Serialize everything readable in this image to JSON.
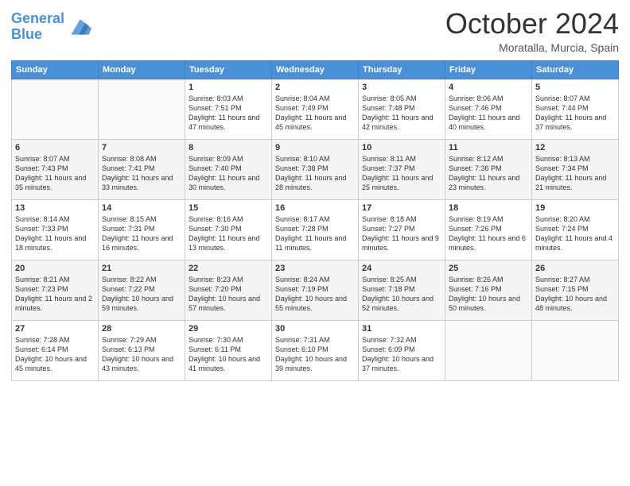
{
  "header": {
    "logo_line1": "General",
    "logo_line2": "Blue",
    "month": "October 2024",
    "location": "Moratalla, Murcia, Spain"
  },
  "days_of_week": [
    "Sunday",
    "Monday",
    "Tuesday",
    "Wednesday",
    "Thursday",
    "Friday",
    "Saturday"
  ],
  "weeks": [
    [
      {
        "day": "",
        "info": ""
      },
      {
        "day": "",
        "info": ""
      },
      {
        "day": "1",
        "info": "Sunrise: 8:03 AM\nSunset: 7:51 PM\nDaylight: 11 hours and 47 minutes."
      },
      {
        "day": "2",
        "info": "Sunrise: 8:04 AM\nSunset: 7:49 PM\nDaylight: 11 hours and 45 minutes."
      },
      {
        "day": "3",
        "info": "Sunrise: 8:05 AM\nSunset: 7:48 PM\nDaylight: 11 hours and 42 minutes."
      },
      {
        "day": "4",
        "info": "Sunrise: 8:06 AM\nSunset: 7:46 PM\nDaylight: 11 hours and 40 minutes."
      },
      {
        "day": "5",
        "info": "Sunrise: 8:07 AM\nSunset: 7:44 PM\nDaylight: 11 hours and 37 minutes."
      }
    ],
    [
      {
        "day": "6",
        "info": "Sunrise: 8:07 AM\nSunset: 7:43 PM\nDaylight: 11 hours and 35 minutes."
      },
      {
        "day": "7",
        "info": "Sunrise: 8:08 AM\nSunset: 7:41 PM\nDaylight: 11 hours and 33 minutes."
      },
      {
        "day": "8",
        "info": "Sunrise: 8:09 AM\nSunset: 7:40 PM\nDaylight: 11 hours and 30 minutes."
      },
      {
        "day": "9",
        "info": "Sunrise: 8:10 AM\nSunset: 7:38 PM\nDaylight: 11 hours and 28 minutes."
      },
      {
        "day": "10",
        "info": "Sunrise: 8:11 AM\nSunset: 7:37 PM\nDaylight: 11 hours and 25 minutes."
      },
      {
        "day": "11",
        "info": "Sunrise: 8:12 AM\nSunset: 7:36 PM\nDaylight: 11 hours and 23 minutes."
      },
      {
        "day": "12",
        "info": "Sunrise: 8:13 AM\nSunset: 7:34 PM\nDaylight: 11 hours and 21 minutes."
      }
    ],
    [
      {
        "day": "13",
        "info": "Sunrise: 8:14 AM\nSunset: 7:33 PM\nDaylight: 11 hours and 18 minutes."
      },
      {
        "day": "14",
        "info": "Sunrise: 8:15 AM\nSunset: 7:31 PM\nDaylight: 11 hours and 16 minutes."
      },
      {
        "day": "15",
        "info": "Sunrise: 8:16 AM\nSunset: 7:30 PM\nDaylight: 11 hours and 13 minutes."
      },
      {
        "day": "16",
        "info": "Sunrise: 8:17 AM\nSunset: 7:28 PM\nDaylight: 11 hours and 11 minutes."
      },
      {
        "day": "17",
        "info": "Sunrise: 8:18 AM\nSunset: 7:27 PM\nDaylight: 11 hours and 9 minutes."
      },
      {
        "day": "18",
        "info": "Sunrise: 8:19 AM\nSunset: 7:26 PM\nDaylight: 11 hours and 6 minutes."
      },
      {
        "day": "19",
        "info": "Sunrise: 8:20 AM\nSunset: 7:24 PM\nDaylight: 11 hours and 4 minutes."
      }
    ],
    [
      {
        "day": "20",
        "info": "Sunrise: 8:21 AM\nSunset: 7:23 PM\nDaylight: 11 hours and 2 minutes."
      },
      {
        "day": "21",
        "info": "Sunrise: 8:22 AM\nSunset: 7:22 PM\nDaylight: 10 hours and 59 minutes."
      },
      {
        "day": "22",
        "info": "Sunrise: 8:23 AM\nSunset: 7:20 PM\nDaylight: 10 hours and 57 minutes."
      },
      {
        "day": "23",
        "info": "Sunrise: 8:24 AM\nSunset: 7:19 PM\nDaylight: 10 hours and 55 minutes."
      },
      {
        "day": "24",
        "info": "Sunrise: 8:25 AM\nSunset: 7:18 PM\nDaylight: 10 hours and 52 minutes."
      },
      {
        "day": "25",
        "info": "Sunrise: 8:26 AM\nSunset: 7:16 PM\nDaylight: 10 hours and 50 minutes."
      },
      {
        "day": "26",
        "info": "Sunrise: 8:27 AM\nSunset: 7:15 PM\nDaylight: 10 hours and 48 minutes."
      }
    ],
    [
      {
        "day": "27",
        "info": "Sunrise: 7:28 AM\nSunset: 6:14 PM\nDaylight: 10 hours and 45 minutes."
      },
      {
        "day": "28",
        "info": "Sunrise: 7:29 AM\nSunset: 6:13 PM\nDaylight: 10 hours and 43 minutes."
      },
      {
        "day": "29",
        "info": "Sunrise: 7:30 AM\nSunset: 6:11 PM\nDaylight: 10 hours and 41 minutes."
      },
      {
        "day": "30",
        "info": "Sunrise: 7:31 AM\nSunset: 6:10 PM\nDaylight: 10 hours and 39 minutes."
      },
      {
        "day": "31",
        "info": "Sunrise: 7:32 AM\nSunset: 6:09 PM\nDaylight: 10 hours and 37 minutes."
      },
      {
        "day": "",
        "info": ""
      },
      {
        "day": "",
        "info": ""
      }
    ]
  ]
}
